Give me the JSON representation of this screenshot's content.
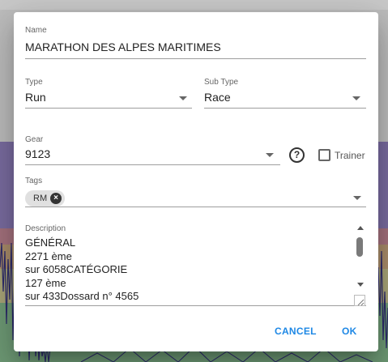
{
  "form": {
    "name": {
      "label": "Name",
      "value": "MARATHON DES ALPES MARITIMES"
    },
    "type": {
      "label": "Type",
      "value": "Run"
    },
    "sub_type": {
      "label": "Sub Type",
      "value": "Race"
    },
    "gear": {
      "label": "Gear",
      "value": "9123"
    },
    "trainer": {
      "label": "Trainer",
      "checked": false
    },
    "tags": {
      "label": "Tags",
      "chips": [
        "RM"
      ]
    },
    "description": {
      "label": "Description",
      "lines": [
        "GÉNÉRAL",
        "2271 ème",
        "sur 6058CATÉGORIE",
        "127 ème",
        "sur 433Dossard n° 4565"
      ]
    }
  },
  "actions": {
    "cancel_label": "CANCEL",
    "ok_label": "OK"
  },
  "icons": {
    "help": "help-circle-icon",
    "chip_remove": "close-circle-icon",
    "dropdown": "chevron-down-icon"
  },
  "colors": {
    "accent": "#1e88e5"
  }
}
